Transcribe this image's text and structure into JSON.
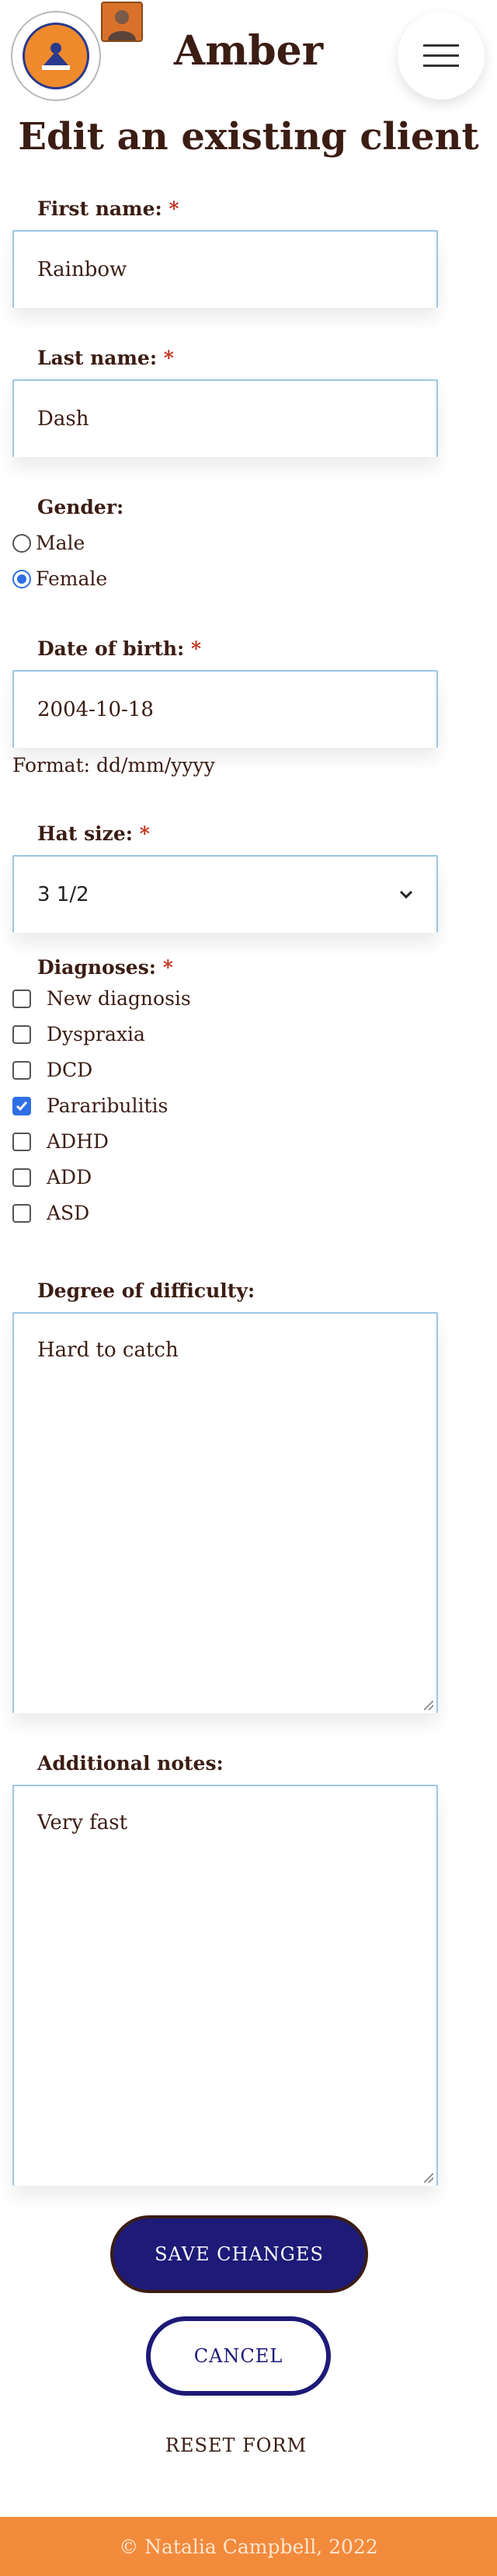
{
  "header": {
    "app_title": "Amber",
    "logo_icon": "organisation-logo-icon",
    "avatar_icon": "user-avatar-icon",
    "menu_icon": "hamburger-menu-icon"
  },
  "page_title": "Edit an existing client",
  "form": {
    "first_name": {
      "label": "First name:",
      "required": "*",
      "value": "Rainbow"
    },
    "last_name": {
      "label": "Last name:",
      "required": "*",
      "value": "Dash"
    },
    "gender": {
      "label": "Gender:",
      "options": [
        {
          "label": "Male",
          "checked": false
        },
        {
          "label": "Female",
          "checked": true
        }
      ]
    },
    "dob": {
      "label": "Date of birth:",
      "required": "*",
      "value": "2004-10-18",
      "hint": "Format: dd/mm/yyyy"
    },
    "hat_size": {
      "label": "Hat size:",
      "required": "*",
      "value": "3 1/2"
    },
    "diagnoses": {
      "label": "Diagnoses:",
      "required": "*",
      "options": [
        {
          "label": "New diagnosis",
          "checked": false
        },
        {
          "label": "Dyspraxia",
          "checked": false
        },
        {
          "label": "DCD",
          "checked": false
        },
        {
          "label": "Pararibulitis",
          "checked": true
        },
        {
          "label": "ADHD",
          "checked": false
        },
        {
          "label": "ADD",
          "checked": false
        },
        {
          "label": "ASD",
          "checked": false
        }
      ]
    },
    "difficulty": {
      "label": "Degree of difficulty:",
      "value": "Hard to catch"
    },
    "notes": {
      "label": "Additional notes:",
      "value": "Very fast"
    }
  },
  "buttons": {
    "save": "SAVE CHANGES",
    "cancel": "CANCEL",
    "reset": "RESET FORM"
  },
  "footer": {
    "text": "© Natalia Campbell, 2022"
  },
  "colors": {
    "primary": "#1d1a78",
    "accent": "#f28a3c",
    "text": "#3b1d14",
    "required": "#c0301a",
    "checked": "#2f6fe4"
  }
}
